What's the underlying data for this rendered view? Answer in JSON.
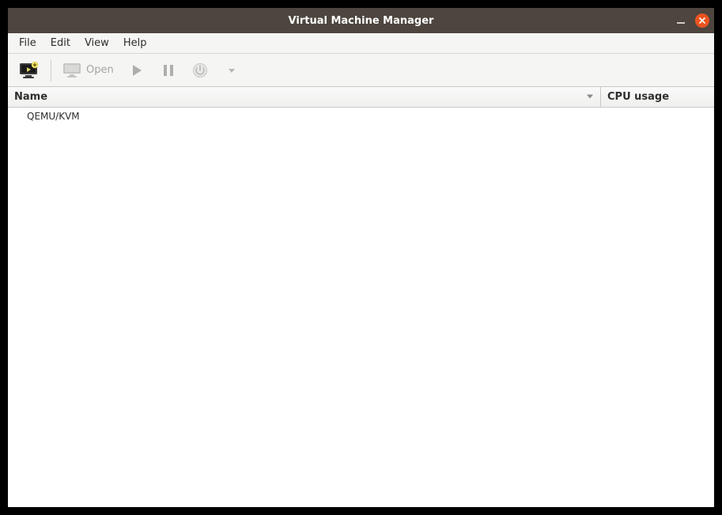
{
  "window": {
    "title": "Virtual Machine Manager"
  },
  "menubar": {
    "items": [
      "File",
      "Edit",
      "View",
      "Help"
    ]
  },
  "toolbar": {
    "open_label": "Open"
  },
  "columns": {
    "name": "Name",
    "cpu": "CPU usage"
  },
  "connections": [
    {
      "label": "QEMU/KVM"
    }
  ]
}
